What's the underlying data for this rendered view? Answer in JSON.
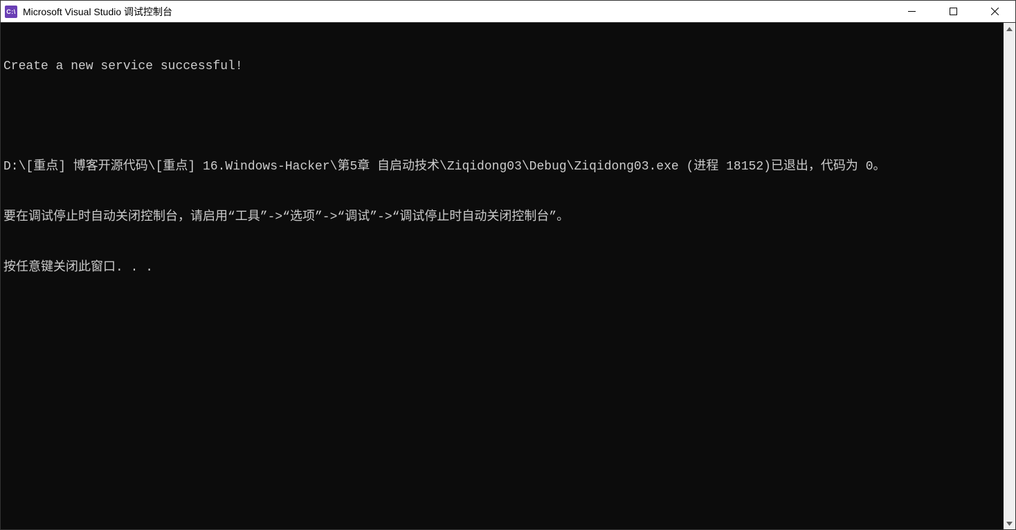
{
  "window": {
    "title": "Microsoft Visual Studio 调试控制台",
    "icon_text": "C:\\"
  },
  "console": {
    "lines": [
      "Create a new service successful!",
      "",
      "D:\\[重点] 博客开源代码\\[重点] 16.Windows-Hacker\\第5章 自启动技术\\Ziqidong03\\Debug\\Ziqidong03.exe (进程 18152)已退出，代码为 0。",
      "要在调试停止时自动关闭控制台，请启用“工具”->“选项”->“调试”->“调试停止时自动关闭控制台”。",
      "按任意键关闭此窗口. . ."
    ]
  }
}
